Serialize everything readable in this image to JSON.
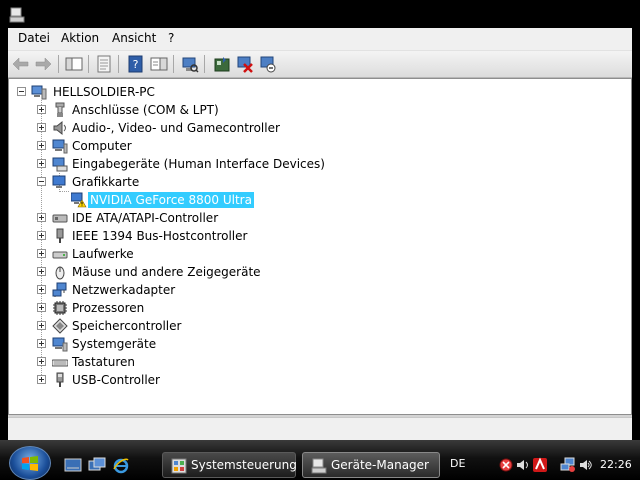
{
  "menu": [
    "Datei",
    "Aktion",
    "Ansicht",
    "?"
  ],
  "tree": {
    "root": "HELLSOLDIER-PC",
    "categories": [
      {
        "label": "Anschlüsse (COM & LPT)",
        "icon": "port-icon"
      },
      {
        "label": "Audio-, Video- und Gamecontroller",
        "icon": "speaker-icon"
      },
      {
        "label": "Computer",
        "icon": "computer-icon"
      },
      {
        "label": "Eingabegeräte (Human Interface Devices)",
        "icon": "hid-icon"
      },
      {
        "label": "Grafikkarte",
        "icon": "display-adapter-icon",
        "expanded": true,
        "children": [
          {
            "label": "NVIDIA GeForce 8800 Ultra",
            "icon": "display-warning-icon",
            "selected": true
          }
        ]
      },
      {
        "label": "IDE ATA/ATAPI-Controller",
        "icon": "ide-icon"
      },
      {
        "label": "IEEE 1394 Bus-Hostcontroller",
        "icon": "firewire-icon"
      },
      {
        "label": "Laufwerke",
        "icon": "drive-icon"
      },
      {
        "label": "Mäuse und andere Zeigegeräte",
        "icon": "mouse-icon"
      },
      {
        "label": "Netzwerkadapter",
        "icon": "network-icon"
      },
      {
        "label": "Prozessoren",
        "icon": "cpu-icon"
      },
      {
        "label": "Speichercontroller",
        "icon": "storage-controller-icon"
      },
      {
        "label": "Systemgeräte",
        "icon": "system-device-icon"
      },
      {
        "label": "Tastaturen",
        "icon": "keyboard-icon"
      },
      {
        "label": "USB-Controller",
        "icon": "usb-icon"
      }
    ]
  },
  "taskbar": {
    "buttons": [
      {
        "label": "Systemsteuerung",
        "active": false
      },
      {
        "label": "Geräte-Manager",
        "active": true
      }
    ],
    "language": "DE",
    "clock": "22:26"
  }
}
